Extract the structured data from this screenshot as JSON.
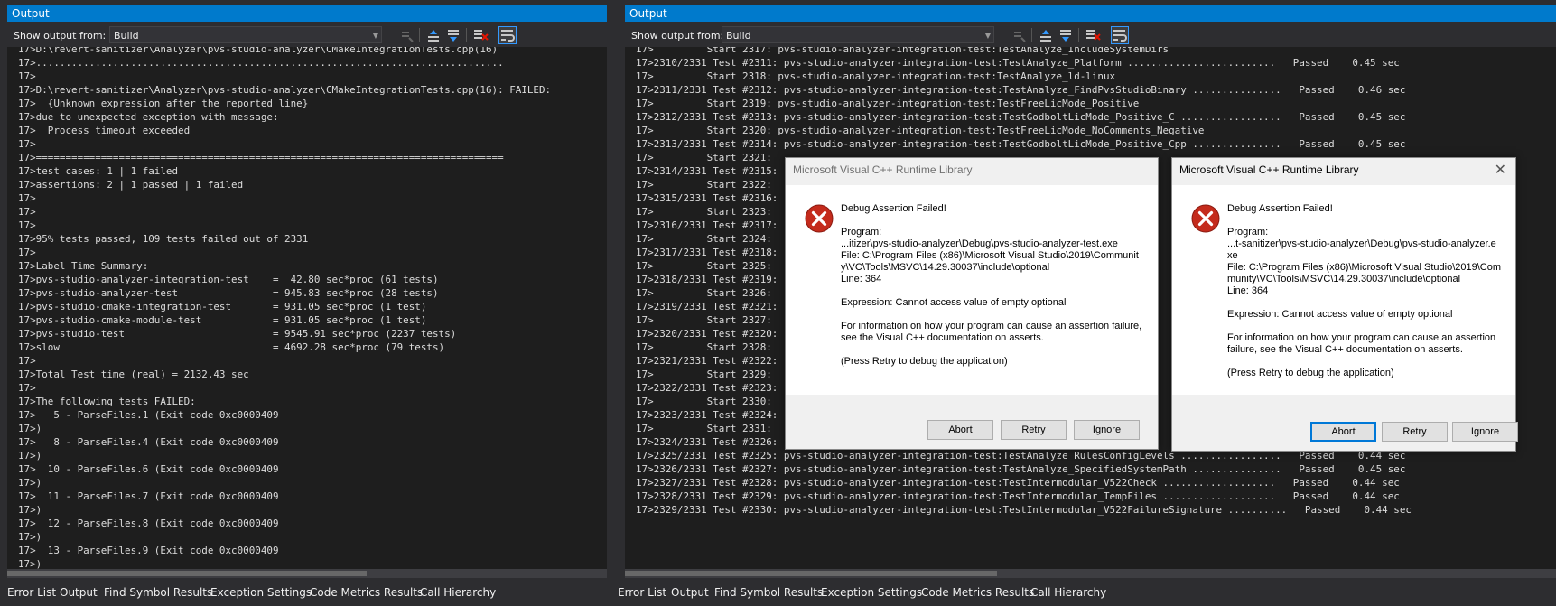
{
  "panel_title": "Output",
  "show_output_label": "Show output from:",
  "show_output_value": "Build",
  "bottom_tabs": [
    "Error List",
    "Output",
    "Find Symbol Results",
    "Exception Settings",
    "Code Metrics Results",
    "Call Hierarchy"
  ],
  "left_output": "17>D:\\revert-sanitizer\\Analyzer\\pvs-studio-analyzer\\CMakeIntegrationTests.cpp(16)\n17>...............................................................................\n17>\n17>D:\\revert-sanitizer\\Analyzer\\pvs-studio-analyzer\\CMakeIntegrationTests.cpp(16): FAILED:\n17>  {Unknown expression after the reported line}\n17>due to unexpected exception with message:\n17>  Process timeout exceeded\n17>\n17>===============================================================================\n17>test cases: 1 | 1 failed\n17>assertions: 2 | 1 passed | 1 failed\n17>\n17>\n17>\n17>95% tests passed, 109 tests failed out of 2331\n17>\n17>Label Time Summary:\n17>pvs-studio-analyzer-integration-test    =  42.80 sec*proc (61 tests)\n17>pvs-studio-analyzer-test                = 945.83 sec*proc (28 tests)\n17>pvs-studio-cmake-integration-test       = 931.05 sec*proc (1 test)\n17>pvs-studio-cmake-module-test            = 931.05 sec*proc (1 test)\n17>pvs-studio-test                         = 9545.91 sec*proc (2237 tests)\n17>slow                                    = 4692.28 sec*proc (79 tests)\n17>\n17>Total Test time (real) = 2132.43 sec\n17>\n17>The following tests FAILED:\n17>   5 - ParseFiles.1 (Exit code 0xc0000409\n17>)\n17>   8 - ParseFiles.4 (Exit code 0xc0000409\n17>)\n17>  10 - ParseFiles.6 (Exit code 0xc0000409\n17>)\n17>  11 - ParseFiles.7 (Exit code 0xc0000409\n17>)\n17>  12 - ParseFiles.8 (Exit code 0xc0000409\n17>)\n17>  13 - ParseFiles.9 (Exit code 0xc0000409\n17>)",
  "right_output": "17>         Start 2317: pvs-studio-analyzer-integration-test:TestAnalyze_IncludeSystemDirs\n17>2310/2331 Test #2311: pvs-studio-analyzer-integration-test:TestAnalyze_Platform .........................   Passed    0.45 sec\n17>         Start 2318: pvs-studio-analyzer-integration-test:TestAnalyze_ld-linux\n17>2311/2331 Test #2312: pvs-studio-analyzer-integration-test:TestAnalyze_FindPvsStudioBinary ...............   Passed    0.46 sec\n17>         Start 2319: pvs-studio-analyzer-integration-test:TestFreeLicMode_Positive\n17>2312/2331 Test #2313: pvs-studio-analyzer-integration-test:TestGodboltLicMode_Positive_C .................   Passed    0.45 sec\n17>         Start 2320: pvs-studio-analyzer-integration-test:TestFreeLicMode_NoComments_Negative\n17>2313/2331 Test #2314: pvs-studio-analyzer-integration-test:TestGodboltLicMode_Positive_Cpp ...............   Passed    0.45 sec\n17>         Start 2321:\n17>2314/2331 Test #2315:\n17>         Start 2322:\n17>2315/2331 Test #2316:\n17>         Start 2323:\n17>2316/2331 Test #2317:\n17>         Start 2324:\n17>2317/2331 Test #2318:\n17>         Start 2325:\n17>2318/2331 Test #2319:\n17>         Start 2326:\n17>2319/2331 Test #2321:\n17>         Start 2327:\n17>2320/2331 Test #2320:\n17>         Start 2328:\n17>2321/2331 Test #2322:\n17>         Start 2329:\n17>2322/2331 Test #2323:\n17>         Start 2330:\n17>2323/2331 Test #2324:\n17>         Start 2331:\n17>2324/2331 Test #2326:\n17>2325/2331 Test #2325: pvs-studio-analyzer-integration-test:TestAnalyze_RulesConfigLevels .................   Passed    0.44 sec\n17>2326/2331 Test #2327: pvs-studio-analyzer-integration-test:TestAnalyze_SpecifiedSystemPath ...............   Passed    0.45 sec\n17>2327/2331 Test #2328: pvs-studio-analyzer-integration-test:TestIntermodular_V522Check ...................   Passed    0.44 sec\n17>2328/2331 Test #2329: pvs-studio-analyzer-integration-test:TestIntermodular_TempFiles ...................   Passed    0.44 sec\n17>2329/2331 Test #2330: pvs-studio-analyzer-integration-test:TestIntermodular_V522FailureSignature ..........   Passed    0.44 sec",
  "dialogs": [
    {
      "title": "Microsoft Visual C++ Runtime Library",
      "heading": "Debug Assertion Failed!",
      "program_label": "Program:",
      "program_path": "...itizer\\pvs-studio-analyzer\\Debug\\pvs-studio-analyzer-test.exe",
      "file": "File: C:\\Program Files (x86)\\Microsoft Visual Studio\\2019\\Community\\VC\\Tools\\MSVC\\14.29.30037\\include\\optional",
      "line": "Line: 364",
      "expression": "Expression: Cannot access value of empty optional",
      "info": "For information on how your program can cause an assertion failure, see the Visual C++ documentation on asserts.",
      "retry_hint": "(Press Retry to debug the application)",
      "buttons": [
        "Abort",
        "Retry",
        "Ignore"
      ]
    },
    {
      "title": "Microsoft Visual C++ Runtime Library",
      "heading": "Debug Assertion Failed!",
      "program_label": "Program:",
      "program_path": "...t-sanitizer\\pvs-studio-analyzer\\Debug\\pvs-studio-analyzer.exe",
      "file": "File: C:\\Program Files (x86)\\Microsoft Visual Studio\\2019\\Community\\VC\\Tools\\MSVC\\14.29.30037\\include\\optional",
      "line": "Line: 364",
      "expression": "Expression: Cannot access value of empty optional",
      "info": "For information on how your program can cause an assertion failure, see the Visual C++ documentation on asserts.",
      "retry_hint": "(Press Retry to debug the application)",
      "buttons": [
        "Abort",
        "Retry",
        "Ignore"
      ]
    }
  ],
  "colors": {
    "accent": "#007acc",
    "background": "#2d2d30",
    "output_bg": "#1e1e1e",
    "error_red": "#c42b1c"
  }
}
